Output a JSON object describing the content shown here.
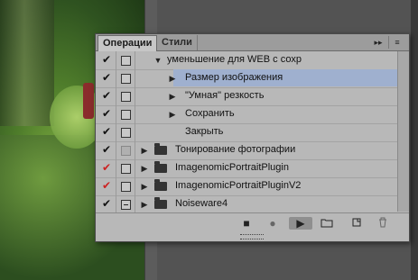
{
  "tabs": {
    "active": "Операции",
    "inactive": "Стили"
  },
  "toolbar": {
    "collapse_icon": "▸▸",
    "menu_icon": "≡"
  },
  "rows": [
    {
      "label": "уменьшение для WEB с сохр",
      "check": "✔",
      "red": false,
      "box": "box",
      "expander": "down",
      "indent": 1,
      "folder": false,
      "selected": false
    },
    {
      "label": "Размер изображения",
      "check": "✔",
      "red": false,
      "box": "box",
      "expander": "right",
      "indent": 2,
      "folder": false,
      "selected": true
    },
    {
      "label": "\"Умная\" резкость",
      "check": "✔",
      "red": false,
      "box": "box",
      "expander": "right",
      "indent": 2,
      "folder": false,
      "selected": false
    },
    {
      "label": "Сохранить",
      "check": "✔",
      "red": false,
      "box": "box",
      "expander": "right",
      "indent": 2,
      "folder": false,
      "selected": false
    },
    {
      "label": "Закрыть",
      "check": "✔",
      "red": false,
      "box": "box",
      "expander": "",
      "indent": 2,
      "folder": false,
      "selected": false
    },
    {
      "label": "Тонирование фотографии",
      "check": "✔",
      "red": false,
      "box": "gray",
      "expander": "right",
      "indent": 0,
      "folder": true,
      "selected": false
    },
    {
      "label": "ImagenomicPortraitPlugin",
      "check": "✔",
      "red": true,
      "box": "box",
      "expander": "right",
      "indent": 0,
      "folder": true,
      "selected": false
    },
    {
      "label": "ImagenomicPortraitPluginV2",
      "check": "✔",
      "red": true,
      "box": "box",
      "expander": "right",
      "indent": 0,
      "folder": true,
      "selected": false
    },
    {
      "label": "Noiseware4",
      "check": "✔",
      "red": false,
      "box": "dash",
      "expander": "right",
      "indent": 0,
      "folder": true,
      "selected": false
    }
  ],
  "bottom": {
    "stop_icon": "■",
    "record_icon": "●",
    "play_icon": "▶",
    "new_set_icon": "folder",
    "new_action_icon": "new-page",
    "delete_icon": "trash"
  }
}
